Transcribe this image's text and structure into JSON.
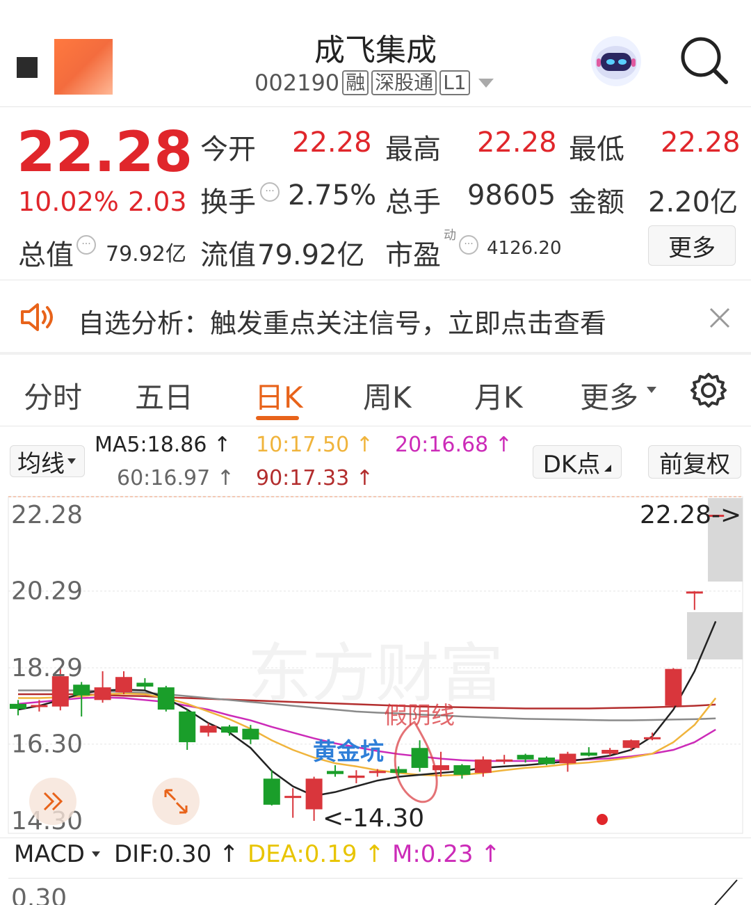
{
  "header": {
    "title": "成飞集成",
    "code": "002190",
    "tags": [
      "融",
      "深股通",
      "L1"
    ]
  },
  "quote": {
    "price": "22.28",
    "change_pct": "10.02%",
    "change": "2.03",
    "open_label": "今开",
    "open": "22.28",
    "high_label": "最高",
    "high": "22.28",
    "low_label": "最低",
    "low": "22.28",
    "turnover_label": "换手",
    "turnover": "2.75%",
    "volume_label": "总手",
    "volume": "98605",
    "amount_label": "金额",
    "amount": "2.20亿",
    "mktcap_label": "总值",
    "mktcap": "79.92亿",
    "float_label": "流值",
    "float": "79.92亿",
    "pe_label": "市盈",
    "pe_sup": "动",
    "pe": "4126.20",
    "more_button": "更多"
  },
  "notice": {
    "text": "自选分析：触发重点关注信号，立即点击查看"
  },
  "tabs": [
    {
      "label": "分时"
    },
    {
      "label": "五日"
    },
    {
      "label": "日K"
    },
    {
      "label": "周K"
    },
    {
      "label": "月K"
    },
    {
      "label": "更多"
    }
  ],
  "active_tab": "日K",
  "chart_toolbar": {
    "ma_select": "均线",
    "ma5": "MA5:18.86",
    "ma10": "10:17.50",
    "ma20": "20:16.68",
    "ma60": "60:16.97",
    "ma90": "90:17.33",
    "dk_button": "DK点",
    "adjust_button": "前复权"
  },
  "chart": {
    "y_labels": [
      "22.28",
      "20.29",
      "18.29",
      "16.30",
      "14.30"
    ],
    "last_price_tag": "22.28->",
    "low_tag": "<-14.30",
    "annotation_pit": "黄金坑",
    "annotation_fake": "假阴线",
    "watermark": "东方财富"
  },
  "macd_bar": {
    "select": "MACD",
    "dif": "DIF:0.30",
    "dea": "DEA:0.19",
    "m": "M:0.23",
    "y_label": "0.30"
  },
  "colors": {
    "up": "#d9363c",
    "down": "#1a9e2a",
    "ma5": "#222222",
    "ma10": "#f0b43c",
    "ma20": "#cc2bb8",
    "ma60": "#8a8a8a",
    "ma90": "#b32e2e",
    "accent": "#e8631a"
  },
  "chart_data": {
    "type": "candlestick",
    "y_range": [
      14.3,
      22.28
    ],
    "candles": [
      {
        "o": 17.22,
        "h": 17.45,
        "l": 17.05,
        "c": 17.35,
        "d": "down"
      },
      {
        "o": 17.32,
        "h": 17.45,
        "l": 17.15,
        "c": 17.28,
        "d": "up"
      },
      {
        "o": 17.28,
        "h": 18.3,
        "l": 17.18,
        "c": 18.07,
        "d": "up"
      },
      {
        "o": 17.85,
        "h": 17.92,
        "l": 17.02,
        "c": 17.57,
        "d": "down"
      },
      {
        "o": 17.45,
        "h": 18.2,
        "l": 17.38,
        "c": 17.78,
        "d": "up"
      },
      {
        "o": 17.65,
        "h": 18.2,
        "l": 17.6,
        "c": 18.05,
        "d": "up"
      },
      {
        "o": 17.9,
        "h": 18.02,
        "l": 17.72,
        "c": 17.8,
        "d": "down"
      },
      {
        "o": 17.78,
        "h": 17.82,
        "l": 17.15,
        "c": 17.2,
        "d": "down"
      },
      {
        "o": 17.15,
        "h": 17.2,
        "l": 16.15,
        "c": 16.35,
        "d": "down"
      },
      {
        "o": 16.6,
        "h": 16.85,
        "l": 16.5,
        "c": 16.78,
        "d": "up"
      },
      {
        "o": 16.76,
        "h": 16.8,
        "l": 16.52,
        "c": 16.6,
        "d": "down"
      },
      {
        "o": 16.7,
        "h": 16.8,
        "l": 16.3,
        "c": 16.42,
        "d": "down"
      },
      {
        "o": 15.4,
        "h": 15.62,
        "l": 14.7,
        "c": 14.72,
        "d": "down"
      },
      {
        "o": 14.9,
        "h": 15.15,
        "l": 14.38,
        "c": 14.95,
        "d": "up"
      },
      {
        "o": 14.6,
        "h": 15.45,
        "l": 14.3,
        "c": 15.4,
        "d": "up"
      },
      {
        "o": 15.6,
        "h": 15.75,
        "l": 15.45,
        "c": 15.52,
        "d": "down"
      },
      {
        "o": 15.42,
        "h": 15.62,
        "l": 15.28,
        "c": 15.48,
        "d": "up"
      },
      {
        "o": 15.55,
        "h": 15.65,
        "l": 15.45,
        "c": 15.6,
        "d": "up"
      },
      {
        "o": 15.65,
        "h": 15.72,
        "l": 15.48,
        "c": 15.55,
        "d": "down"
      },
      {
        "o": 16.2,
        "h": 16.4,
        "l": 15.58,
        "c": 15.68,
        "d": "down"
      },
      {
        "o": 15.62,
        "h": 16.1,
        "l": 15.45,
        "c": 15.75,
        "d": "up"
      },
      {
        "o": 15.75,
        "h": 15.78,
        "l": 15.4,
        "c": 15.5,
        "d": "down"
      },
      {
        "o": 15.55,
        "h": 15.98,
        "l": 15.45,
        "c": 15.9,
        "d": "up"
      },
      {
        "o": 15.85,
        "h": 16.02,
        "l": 15.78,
        "c": 15.9,
        "d": "up"
      },
      {
        "o": 15.9,
        "h": 16.05,
        "l": 15.82,
        "c": 16.02,
        "d": "down"
      },
      {
        "o": 15.95,
        "h": 15.98,
        "l": 15.75,
        "c": 15.78,
        "d": "down"
      },
      {
        "o": 15.8,
        "h": 16.1,
        "l": 15.58,
        "c": 16.05,
        "d": "up"
      },
      {
        "o": 16.0,
        "h": 16.22,
        "l": 15.98,
        "c": 16.08,
        "d": "down"
      },
      {
        "o": 16.05,
        "h": 16.2,
        "l": 16.0,
        "c": 16.15,
        "d": "up"
      },
      {
        "o": 16.2,
        "h": 16.42,
        "l": 16.12,
        "c": 16.4,
        "d": "up"
      },
      {
        "o": 16.45,
        "h": 16.6,
        "l": 16.4,
        "c": 16.48,
        "d": "up"
      },
      {
        "o": 17.3,
        "h": 18.28,
        "l": 17.25,
        "c": 18.26,
        "d": "up"
      },
      {
        "o": 20.26,
        "h": 20.29,
        "l": 19.8,
        "c": 20.28,
        "d": "up"
      },
      {
        "o": 22.28,
        "h": 22.28,
        "l": 22.28,
        "c": 22.28,
        "d": "up"
      }
    ],
    "ma5": [
      17.2,
      17.3,
      17.45,
      17.62,
      17.7,
      17.72,
      17.7,
      17.5,
      17.2,
      16.85,
      16.6,
      16.2,
      15.6,
      15.2,
      14.95,
      15.05,
      15.2,
      15.35,
      15.45,
      15.5,
      15.55,
      15.6,
      15.68,
      15.72,
      15.75,
      15.8,
      15.85,
      15.92,
      16.0,
      16.15,
      16.5,
      17.2,
      18.2,
      19.5
    ],
    "ma10": [
      17.5,
      17.5,
      17.52,
      17.55,
      17.6,
      17.62,
      17.6,
      17.5,
      17.35,
      17.15,
      16.95,
      16.7,
      16.4,
      16.15,
      15.95,
      15.8,
      15.72,
      15.62,
      15.55,
      15.5,
      15.48,
      15.5,
      15.55,
      15.62,
      15.68,
      15.72,
      15.78,
      15.82,
      15.88,
      15.95,
      16.05,
      16.35,
      16.8,
      17.5
    ],
    "ma20": [
      17.35,
      17.4,
      17.45,
      17.5,
      17.52,
      17.5,
      17.45,
      17.4,
      17.3,
      17.2,
      17.05,
      16.92,
      16.75,
      16.6,
      16.45,
      16.32,
      16.22,
      16.12,
      16.04,
      15.98,
      15.92,
      15.88,
      15.86,
      15.86,
      15.86,
      15.87,
      15.88,
      15.9,
      15.93,
      15.98,
      16.05,
      16.15,
      16.35,
      16.68
    ],
    "ma60": [
      17.7,
      17.7,
      17.7,
      17.7,
      17.68,
      17.66,
      17.64,
      17.6,
      17.55,
      17.5,
      17.45,
      17.4,
      17.35,
      17.3,
      17.25,
      17.2,
      17.15,
      17.12,
      17.1,
      17.07,
      17.05,
      17.02,
      17.0,
      16.98,
      16.96,
      16.95,
      16.94,
      16.93,
      16.92,
      16.92,
      16.93,
      16.94,
      16.95,
      16.97
    ],
    "ma90": [
      17.6,
      17.6,
      17.6,
      17.6,
      17.58,
      17.56,
      17.55,
      17.52,
      17.5,
      17.48,
      17.46,
      17.44,
      17.42,
      17.4,
      17.38,
      17.36,
      17.34,
      17.32,
      17.3,
      17.28,
      17.27,
      17.26,
      17.25,
      17.24,
      17.23,
      17.23,
      17.23,
      17.23,
      17.24,
      17.25,
      17.26,
      17.28,
      17.3,
      17.33
    ]
  }
}
